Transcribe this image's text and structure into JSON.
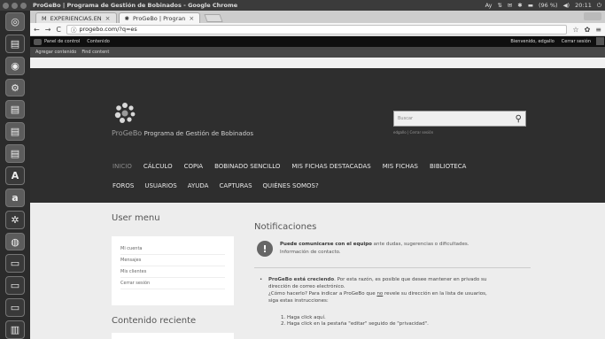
{
  "topbar": {
    "window_title": "ProGeBo | Programa de Gestión de Bobinados - Google Chrome",
    "clock": "20:11",
    "battery": "(96 %)"
  },
  "browser": {
    "tabs": [
      {
        "label": "EXPERIENCIAS.EN"
      },
      {
        "label": "ProGeBo | Progran"
      }
    ],
    "url": "progebo.com/?q=es"
  },
  "admin": {
    "home_label": "Panel de control",
    "content_label": "Contenido",
    "welcome": "Bienvenido, edgallo",
    "logout": "Cerrar sesión",
    "shortcuts": [
      "Agregar contenido",
      "Find content"
    ]
  },
  "header": {
    "brand": "ProGeBo",
    "tagline": "Programa de Gestión de Bobinados",
    "search_placeholder": "Buscar",
    "search_links": "edgallo | Cerrar sesión",
    "menu": [
      "INICIO",
      "CÁLCULO",
      "COPIA",
      "BOBINADO SENCILLO",
      "MIS FICHAS DESTACADAS",
      "MIS FICHAS",
      "BIBLIOTECA"
    ],
    "submenu": [
      "FOROS",
      "USUARIOS",
      "AYUDA",
      "CAPTURAS",
      "QUIÉNES SOMOS?"
    ]
  },
  "sidebar": {
    "user_menu_title": "User menu",
    "user_menu_items": [
      "Mi cuenta",
      "Mensajes",
      "Mis clientes",
      "Cerrar sesión"
    ],
    "recent_title": "Contenido reciente"
  },
  "main": {
    "title": "Notificaciones",
    "notice_bold": "Puede comunicarse con el equipo",
    "notice_rest": " ante dudas, sugerencias o dificultades.",
    "notice_line2": "Información de contacto.",
    "post_bold": "ProGeBo está creciendo",
    "post_line1": ". Por esta razón, es posible que desee mantener en privado su",
    "post_line2": "dirección de correo electrónico.",
    "post_line3a": "¿Cómo hacerlo? Para indicar a ProGeBo que ",
    "post_line3u": "no",
    "post_line3b": " revele su dirección en la lista de usuarios,",
    "post_line4": "siga estas instrucciones:",
    "step1": "1. Haga click aquí.",
    "step2": "2. Haga click en la pestaña \"editar\" seguido de \"privacidad\"."
  }
}
